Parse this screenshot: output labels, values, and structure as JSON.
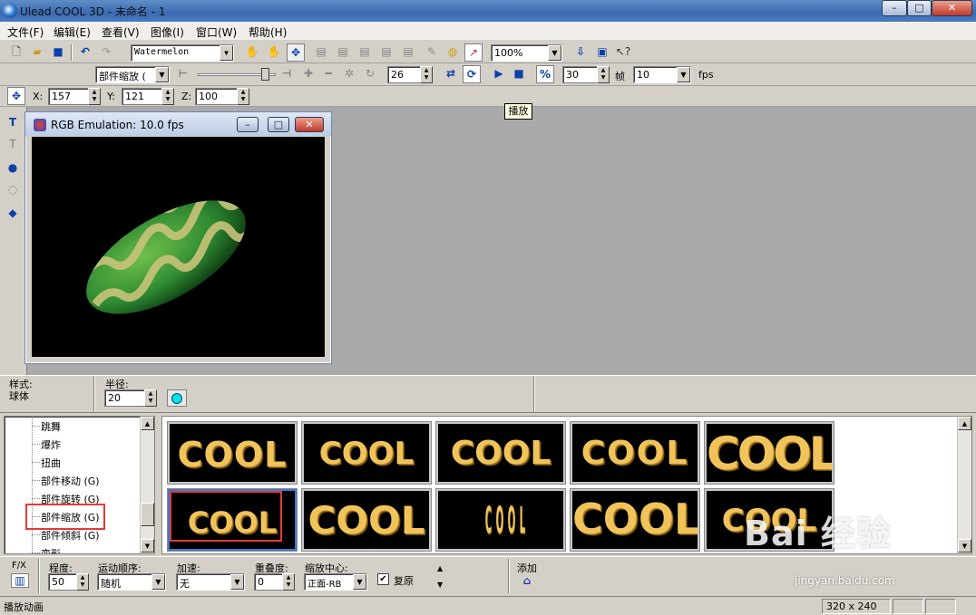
{
  "window": {
    "title": "Ulead COOL 3D - 未命名 - 1",
    "min": "–",
    "max": "□",
    "close": "✕"
  },
  "menu": [
    "文件(F)",
    "编辑(E)",
    "查看(V)",
    "图像(I)",
    "窗口(W)",
    "帮助(H)"
  ],
  "toolbar1": {
    "texture": "Watermelon",
    "zoom": "100%"
  },
  "toolbar2": {
    "effect": "部件缩放 (",
    "frame": "26",
    "total_frames": "30",
    "frame_unit": "帧",
    "fps_value": "10",
    "fps_unit": "fps",
    "tooltip": "播放"
  },
  "toolbar3": {
    "x_label": "X:",
    "x": "157",
    "y_label": "Y:",
    "y": "121",
    "z_label": "Z:",
    "z": "100"
  },
  "preview": {
    "title": "RGB Emulation: 10.0 fps"
  },
  "properties": {
    "style_label": "样式:",
    "style_value": "球体",
    "radius_label": "半径:",
    "radius_value": "20"
  },
  "tree": {
    "items": [
      "跳舞",
      "爆炸",
      "扭曲",
      "部件移动 (G)",
      "部件旋转 (G)",
      "部件缩放 (G)",
      "部件倾斜 (G)",
      "变形"
    ],
    "selected_index": 5
  },
  "thumbnails": {
    "label_text": "COOL",
    "highlighted_index": 5
  },
  "bottom": {
    "fx_label": "F/X",
    "degree_label": "程度:",
    "degree_value": "50",
    "order_label": "运动顺序:",
    "order_value": "随机",
    "accel_label": "加速:",
    "accel_value": "无",
    "overlap_label": "重叠度:",
    "overlap_value": "0",
    "center_label": "缩放中心:",
    "center_value": "正面-RB",
    "restore_label": "复原",
    "restore_checked": true,
    "add_label": "添加"
  },
  "status": {
    "text": "播放动画",
    "size": "320 x 240"
  },
  "watermark": {
    "brand": "Bai 经验",
    "url": "jingyan.baidu.com"
  }
}
